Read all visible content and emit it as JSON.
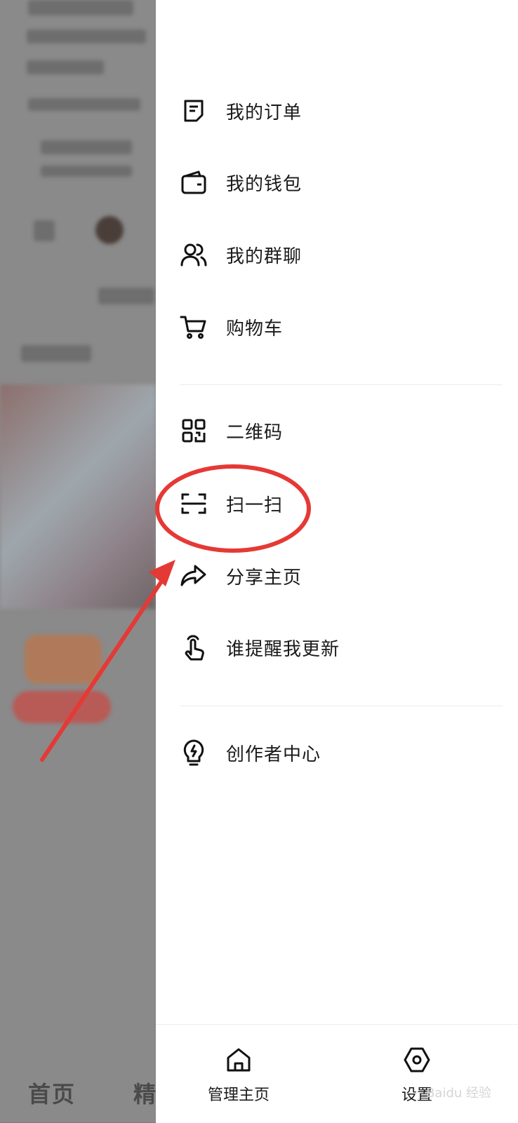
{
  "menu": {
    "items": [
      {
        "label": "我的订单",
        "icon": "order-icon"
      },
      {
        "label": "我的钱包",
        "icon": "wallet-icon"
      },
      {
        "label": "我的群聊",
        "icon": "group-chat-icon"
      },
      {
        "label": "购物车",
        "icon": "cart-icon"
      },
      {
        "label": "二维码",
        "icon": "qr-code-icon"
      },
      {
        "label": "扫一扫",
        "icon": "scan-icon"
      },
      {
        "label": "分享主页",
        "icon": "share-icon"
      },
      {
        "label": "谁提醒我更新",
        "icon": "tap-hand-icon"
      },
      {
        "label": "创作者中心",
        "icon": "lightbulb-icon"
      }
    ]
  },
  "bottom_bar": {
    "manage_home_label": "管理主页",
    "settings_label": "设置"
  },
  "background": {
    "nav_home": "首页",
    "nav_second": "精"
  },
  "watermark": "Baidu 经验",
  "annotation_color": "#e53935"
}
